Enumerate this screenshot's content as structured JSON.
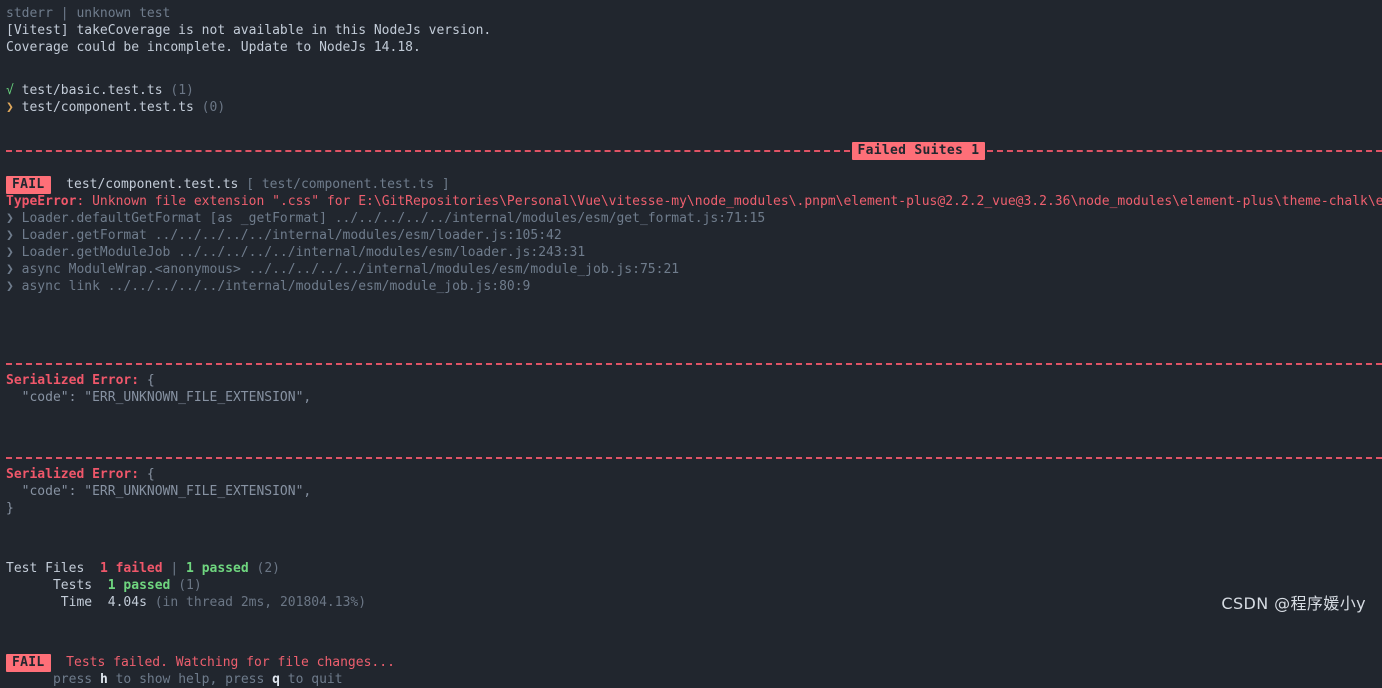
{
  "terminal": {
    "background": "#21262e",
    "stderr_header": {
      "stream": "stderr",
      "divider": "|",
      "label": "unknown test"
    },
    "warning_lines": [
      "[Vitest] takeCoverage is not available in this NodeJs version.",
      "Coverage could be incomplete. Update to NodeJs 14.18."
    ],
    "test_files": [
      {
        "icon": "√",
        "icon_name": "check-icon",
        "path": "test/basic.test.ts",
        "count": "(1)"
      },
      {
        "icon": "❯",
        "icon_name": "chevron-right-icon",
        "path": "test/component.test.ts",
        "count": "(0)"
      }
    ],
    "failed_suites_banner": "Failed Suites 1",
    "failure": {
      "badge": "FAIL",
      "file": "test/component.test.ts",
      "bracket_open": "[",
      "suite": "test/component.test.ts",
      "bracket_close": "]",
      "error_type": "TypeError",
      "error_colon": ":",
      "error_message": " Unknown file extension \".css\" for E:\\GitRepositories\\Personal\\Vue\\vitesse-my\\node_modules\\.pnpm\\element-plus@2.2.2_vue@3.2.36\\node_modules\\element-plus\\theme-chalk\\el-button.css",
      "stack": [
        "❯ Loader.defaultGetFormat [as _getFormat] ../../../../../internal/modules/esm/get_format.js:71:15",
        "❯ Loader.getFormat ../../../../../internal/modules/esm/loader.js:105:42",
        "❯ Loader.getModuleJob ../../../../../internal/modules/esm/loader.js:243:31",
        "❯ async ModuleWrap.<anonymous> ../../../../../internal/modules/esm/module_job.js:75:21",
        "❯ async link ../../../../../internal/modules/esm/module_job.js:80:9"
      ]
    },
    "serialized_errors": [
      {
        "label": "Serialized Error:",
        "brace_open": " {",
        "body": "  \"code\": \"ERR_UNKNOWN_FILE_EXTENSION\",",
        "brace_close": ""
      },
      {
        "label": "Serialized Error:",
        "brace_open": " {",
        "body": "  \"code\": \"ERR_UNKNOWN_FILE_EXTENSION\",",
        "brace_close": "}"
      }
    ],
    "summary": {
      "test_files": {
        "label": "Test Files",
        "failed": "1 failed",
        "divider": "|",
        "passed": "1 passed",
        "total": "(2)"
      },
      "tests": {
        "label": "Tests",
        "passed": "1 passed",
        "total": "(1)"
      },
      "time": {
        "label": "Time",
        "value": "4.04s",
        "detail": "(in thread 2ms, 201804.13%)"
      }
    },
    "footer": {
      "badge": "FAIL",
      "message": "Tests failed. Watching for file changes...",
      "hint_pre": "press ",
      "hint_key_help": "h",
      "hint_mid": " to show help, press ",
      "hint_key_quit": "q",
      "hint_post": " to quit"
    },
    "watermark": "CSDN @程序媛小y"
  }
}
